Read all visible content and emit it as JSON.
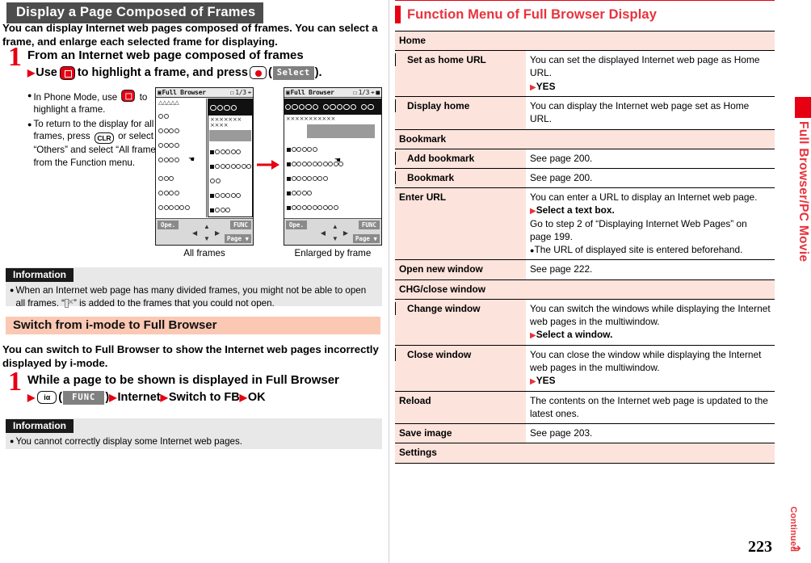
{
  "left": {
    "section_header": "Display a Page Composed of Frames",
    "intro": "You can display Internet web pages composed of frames. You can select a frame, and enlarge each selected frame for displaying.",
    "step1": {
      "number": "1",
      "title": "From an Internet web page composed of frames",
      "sub_prefix": "Use",
      "sub_mid": "to highlight a frame, and press",
      "softkey_label": "Select",
      "sub_suffix": ").",
      "open_paren": "(",
      "bullets": [
        "In Phone Mode, use ⊡ to highlight a frame.",
        "To return to the display for all frames, press CLR or select “Others” and select “All frames” from the Function menu."
      ],
      "bullet1_pre": "In Phone Mode, use",
      "bullet1_post": "to highlight a frame.",
      "bullet2_pre": "To return to the display for all frames, press",
      "bullet2_key": "CLR",
      "bullet2_post": "or select “Others” and select “All frames” from the Function menu."
    },
    "screens": {
      "title_bar": "Full Browser",
      "page_indicator": "1/3",
      "softkey_ope": "Ope.",
      "softkey_func": "FUNC",
      "softkey_page": "Page",
      "caption_left": "All frames",
      "caption_right": "Enlarged by frame"
    },
    "info1": {
      "tag": "Information",
      "text_a": "When an Internet web page has many divided frames, you might not be able to open all frames. “",
      "text_b": "” is added to the frames that you could not open."
    },
    "section2_header": "Switch from i-mode to Full Browser",
    "section2_intro": "You can switch to Full Browser to show the Internet web pages incorrectly displayed by i-mode.",
    "step2": {
      "number": "1",
      "title": "While a page to be shown is displayed in Full Browser",
      "key_label": "iα",
      "softkey_label": "FUNC",
      "path": [
        "Internet",
        "Switch to FB",
        "OK"
      ],
      "open_paren": "(",
      "close_paren": ")"
    },
    "info2": {
      "tag": "Information",
      "text": "You cannot correctly display some Internet web pages."
    }
  },
  "right": {
    "section_title": "Function Menu of Full Browser Display",
    "table": [
      {
        "kind": "group",
        "label": "Home"
      },
      {
        "kind": "row",
        "indent": true,
        "label": "Set as home URL",
        "lines": [
          {
            "t": "text",
            "v": "You can set the displayed Internet web page as Home URL."
          },
          {
            "t": "action",
            "v": "YES"
          }
        ]
      },
      {
        "kind": "row",
        "indent": true,
        "label": "Display home",
        "lines": [
          {
            "t": "text",
            "v": "You can display the Internet web page set as Home URL."
          }
        ]
      },
      {
        "kind": "group",
        "label": "Bookmark"
      },
      {
        "kind": "row",
        "indent": true,
        "label": "Add bookmark",
        "lines": [
          {
            "t": "text",
            "v": "See page 200."
          }
        ]
      },
      {
        "kind": "row",
        "indent": true,
        "label": "Bookmark",
        "lines": [
          {
            "t": "text",
            "v": "See page 200."
          }
        ]
      },
      {
        "kind": "row",
        "indent": false,
        "label": "Enter URL",
        "lines": [
          {
            "t": "text",
            "v": "You can enter a URL to display an Internet web page."
          },
          {
            "t": "action",
            "v": "Select a text box."
          },
          {
            "t": "text",
            "v": "Go to step 2 of “Displaying Internet Web Pages” on page 199."
          },
          {
            "t": "bullet",
            "v": "The URL of displayed site is entered beforehand."
          }
        ]
      },
      {
        "kind": "row",
        "indent": false,
        "label": "Open new window",
        "lines": [
          {
            "t": "text",
            "v": "See page 222."
          }
        ]
      },
      {
        "kind": "group",
        "label": "CHG/close window"
      },
      {
        "kind": "row",
        "indent": true,
        "label": "Change window",
        "lines": [
          {
            "t": "text",
            "v": "You can switch the windows while displaying the Internet web pages in the multiwindow."
          },
          {
            "t": "action",
            "v": "Select a window."
          }
        ]
      },
      {
        "kind": "row",
        "indent": true,
        "label": "Close window",
        "lines": [
          {
            "t": "text",
            "v": "You can close the window while displaying the Internet web pages in the multiwindow."
          },
          {
            "t": "action",
            "v": "YES"
          }
        ]
      },
      {
        "kind": "row",
        "indent": false,
        "label": "Reload",
        "lines": [
          {
            "t": "text",
            "v": "The contents on the Internet web page is updated to the latest ones."
          }
        ]
      },
      {
        "kind": "row",
        "indent": false,
        "label": "Save image",
        "lines": [
          {
            "t": "text",
            "v": "See page 203."
          }
        ]
      },
      {
        "kind": "group",
        "label": "Settings"
      }
    ]
  },
  "footer": {
    "side_tab_label": "Full Browser/PC Movie",
    "page_number": "223",
    "continued": "Continued"
  },
  "colors": {
    "accent_red": "#e60012",
    "title_red": "#e8323c",
    "pink_header": "#fbc8b4",
    "table_pink": "#fce3dc",
    "info_gray": "#e8e8e8",
    "dark_header": "#4d4d4d"
  }
}
